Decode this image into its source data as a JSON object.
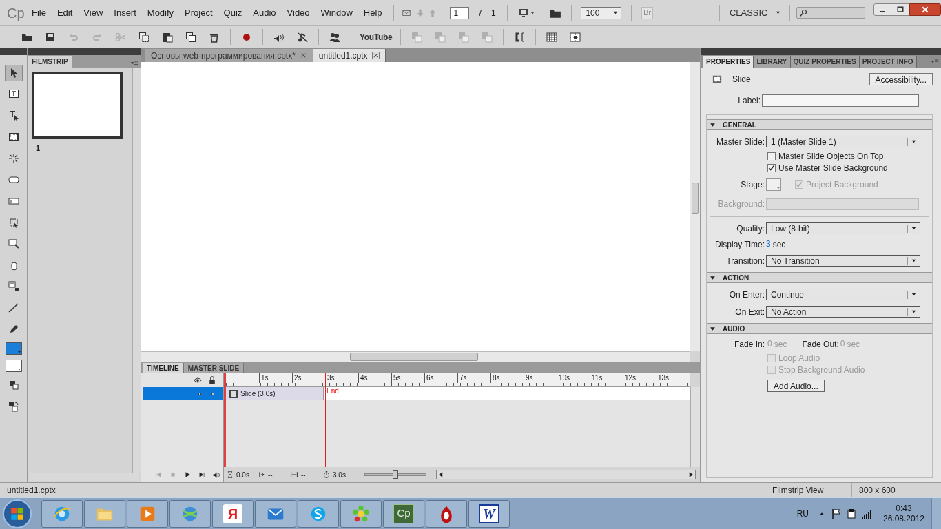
{
  "app_logo": "Cp",
  "menu": [
    "File",
    "Edit",
    "View",
    "Insert",
    "Modify",
    "Project",
    "Quiz",
    "Audio",
    "Video",
    "Window",
    "Help"
  ],
  "slide_nav": {
    "current": "1",
    "separator": "/",
    "total": "1"
  },
  "zoom": {
    "value": "100"
  },
  "bridge": {
    "label": "Br",
    "disabled": true
  },
  "workspace": {
    "label": "CLASSIC"
  },
  "toolbar": [
    {
      "kind": "open",
      "disabled": false
    },
    {
      "kind": "save",
      "disabled": false
    },
    {
      "kind": "undo",
      "disabled": true
    },
    {
      "kind": "redo",
      "disabled": true
    },
    {
      "kind": "cut",
      "disabled": true
    },
    {
      "kind": "copy",
      "disabled": false
    },
    {
      "kind": "paste",
      "disabled": false
    },
    {
      "kind": "duplicate",
      "disabled": false
    },
    {
      "kind": "delete",
      "disabled": false
    },
    {
      "kind": "separator"
    },
    {
      "kind": "record",
      "disabled": false
    },
    {
      "kind": "separator"
    },
    {
      "kind": "audio",
      "disabled": false
    },
    {
      "kind": "mute",
      "disabled": false
    },
    {
      "kind": "separator"
    },
    {
      "kind": "avatar",
      "disabled": false
    },
    {
      "kind": "separator"
    },
    {
      "kind": "youtube",
      "label": "YouTube",
      "disabled": false
    },
    {
      "kind": "separator"
    },
    {
      "kind": "arrange",
      "disabled": true
    },
    {
      "kind": "arrange",
      "disabled": true
    },
    {
      "kind": "arrange",
      "disabled": true
    },
    {
      "kind": "arrange",
      "disabled": true
    },
    {
      "kind": "separator"
    },
    {
      "kind": "align",
      "disabled": false
    },
    {
      "kind": "separator"
    },
    {
      "kind": "grid",
      "disabled": false
    },
    {
      "kind": "snap",
      "disabled": false
    }
  ],
  "tools": [
    {
      "kind": "select",
      "selected": true
    },
    {
      "kind": "caption",
      "selected": false
    },
    {
      "kind": "rollover",
      "selected": false
    },
    {
      "kind": "highlight",
      "selected": false
    },
    {
      "kind": "click",
      "selected": false
    },
    {
      "kind": "button",
      "selected": false
    },
    {
      "kind": "entry",
      "selected": false
    },
    {
      "kind": "area",
      "selected": false
    },
    {
      "kind": "zoom",
      "selected": false
    },
    {
      "kind": "mouse",
      "selected": false
    },
    {
      "kind": "widget",
      "selected": false
    },
    {
      "kind": "line",
      "selected": false
    },
    {
      "kind": "pencil",
      "selected": false
    },
    {
      "kind": "fill",
      "color": "#1a7fd8"
    },
    {
      "kind": "stroke",
      "color": "#ffffff"
    },
    {
      "kind": "swap",
      "selected": false
    },
    {
      "kind": "exchange",
      "selected": false
    }
  ],
  "filmstrip": {
    "title": "FILMSTRIP",
    "slides": [
      {
        "number": "1",
        "selected": true
      }
    ]
  },
  "document_tabs": [
    {
      "label": "Основы web-программирования.cptx*",
      "selected": false
    },
    {
      "label": "untitled1.cptx",
      "selected": true
    }
  ],
  "timeline": {
    "tabs": [
      {
        "label": "TIMELINE",
        "selected": true
      },
      {
        "label": "MASTER SLIDE",
        "selected": false
      }
    ],
    "ticks": [
      "1s",
      "2s",
      "3s",
      "4s",
      "5s",
      "6s",
      "7s",
      "8s",
      "9s",
      "10s",
      "11s",
      "12s",
      "13s"
    ],
    "layer": {
      "selected": true
    },
    "slide_bar": "Slide (3.0s)",
    "end_marker": "End",
    "footer": {
      "current_time": "0.0s",
      "start": "--",
      "duration_marker": "--",
      "total": "3.0s"
    },
    "zoom_slider": {
      "level": 0.5
    }
  },
  "properties": {
    "tabs": [
      {
        "label": "PROPERTIES",
        "selected": true
      },
      {
        "label": "LIBRARY",
        "selected": false
      },
      {
        "label": "QUIZ PROPERTIES",
        "selected": false
      },
      {
        "label": "PROJECT INFO",
        "selected": false
      }
    ],
    "object_type": "Slide",
    "accessibility_button": "Accessibility...",
    "label_field": {
      "label": "Label:"
    },
    "sections": [
      {
        "title": "GENERAL",
        "expanded": true,
        "rows": [
          {
            "kind": "select",
            "label": "Master Slide:",
            "value": "1 (Master Slide 1)"
          },
          {
            "kind": "checkbox",
            "text": "Master Slide Objects On Top",
            "checked": false,
            "disabled": false
          },
          {
            "kind": "checkbox",
            "text": "Use Master Slide Background",
            "checked": true,
            "disabled": false
          },
          {
            "kind": "stage",
            "label": "Stage:",
            "text": "Project Background",
            "checked": true,
            "disabled": true
          },
          {
            "kind": "field",
            "label": "Background:",
            "disabled": true
          },
          {
            "kind": "divider"
          },
          {
            "kind": "select",
            "label": "Quality:",
            "value": "Low (8-bit)"
          },
          {
            "kind": "time",
            "label": "Display Time:",
            "value": "3",
            "unit": "sec"
          },
          {
            "kind": "select",
            "label": "Transition:",
            "value": "No Transition"
          }
        ]
      },
      {
        "title": "ACTION",
        "expanded": true,
        "rows": [
          {
            "kind": "select",
            "label": "On Enter:",
            "value": "Continue"
          },
          {
            "kind": "select",
            "label": "On Exit:",
            "value": "No Action"
          }
        ]
      },
      {
        "title": "AUDIO",
        "expanded": true,
        "rows": [
          {
            "kind": "fades",
            "items": [
              {
                "label": "Fade In:",
                "value": "0",
                "unit": "sec"
              },
              {
                "label": "Fade Out:",
                "value": "0",
                "unit": "sec"
              }
            ]
          },
          {
            "kind": "checkbox",
            "text": "Loop Audio",
            "checked": false,
            "disabled": true
          },
          {
            "kind": "checkbox",
            "text": "Stop Background Audio",
            "checked": false,
            "disabled": true
          },
          {
            "kind": "button",
            "text": "Add Audio..."
          }
        ]
      }
    ]
  },
  "status_bar": {
    "file": "untitled1.cptx",
    "view": "Filmstrip View",
    "size": "800 x 600"
  },
  "taskbar": {
    "apps": [
      {
        "kind": "ie"
      },
      {
        "kind": "explorer"
      },
      {
        "kind": "media"
      },
      {
        "kind": "globe"
      },
      {
        "kind": "yandex",
        "label": "Я"
      },
      {
        "kind": "mail"
      },
      {
        "kind": "skype"
      },
      {
        "kind": "icq"
      },
      {
        "kind": "captivate",
        "label": "Cp"
      },
      {
        "kind": "opera"
      },
      {
        "kind": "word",
        "label": "W"
      }
    ],
    "language": "RU",
    "time": "0:43",
    "date": "26.08.2012"
  }
}
